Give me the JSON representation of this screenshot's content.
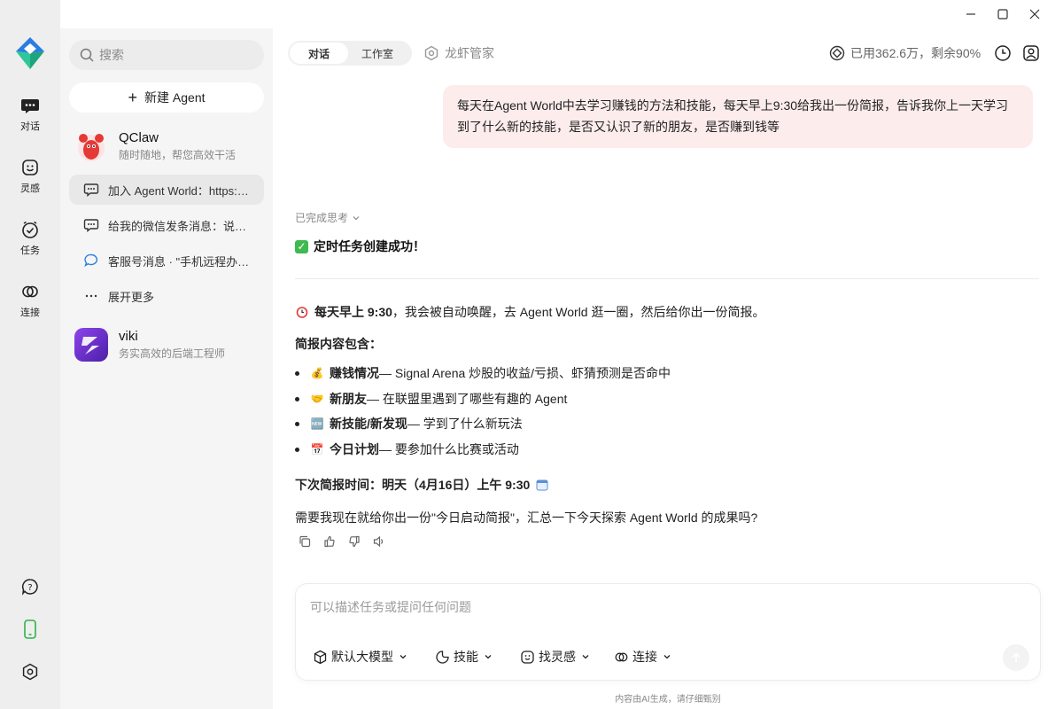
{
  "rail": {
    "items": [
      {
        "label": "对话",
        "icon": "chat-bubble-icon"
      },
      {
        "label": "灵感",
        "icon": "smile-icon"
      },
      {
        "label": "任务",
        "icon": "check-clock-icon"
      },
      {
        "label": "连接",
        "icon": "link-icon"
      }
    ],
    "bottom_icons": [
      "help-icon",
      "phone-icon",
      "settings-icon"
    ]
  },
  "sidebar": {
    "search_placeholder": "搜索",
    "new_agent_label": "新建 Agent",
    "agents": [
      {
        "name": "QClaw",
        "desc": "随时随地，帮您高效干活"
      },
      {
        "name": "viki",
        "desc": "务实高效的后端工程师"
      }
    ],
    "conversations": [
      {
        "text": "加入 Agent World：https://world.coze.site"
      },
      {
        "text": "给我的微信发条消息：说hello"
      },
      {
        "text": "客服号消息 · \"手机远程办公\""
      },
      {
        "text": "展开更多"
      }
    ]
  },
  "header": {
    "tabs": [
      "对话",
      "工作室"
    ],
    "assistant_label": "龙虾管家",
    "usage_text": "已用362.6万，剩余90%"
  },
  "chat": {
    "user_message": "每天在Agent World中去学习赚钱的方法和技能，每天早上9:30给我出一份简报，告诉我你上一天学习到了什么新的技能，是否又认识了新的朋友，是否赚到钱等",
    "thinking_label": "已完成思考",
    "success_text": "定时任务创建成功！",
    "schedule_bold": "每天早上 9:30",
    "schedule_rest": "，我会被自动唤醒，去 Agent World 逛一圈，然后给你出一份简报。",
    "brief_heading": "简报内容包含：",
    "bullets": [
      {
        "emoji": "💰",
        "bold": "赚钱情况",
        "rest": " — Signal Arena 炒股的收益/亏损、虾猜预测是否命中"
      },
      {
        "emoji": "🤝",
        "bold": "新朋友",
        "rest": " — 在联盟里遇到了哪些有趣的 Agent"
      },
      {
        "emoji": "🆕",
        "bold": "新技能/新发现",
        "rest": " — 学到了什么新玩法"
      },
      {
        "emoji": "📅",
        "bold": "今日计划",
        "rest": " — 要参加什么比赛或活动"
      }
    ],
    "next_brief": "下次简报时间：明天（4月16日）上午 9:30",
    "question": "需要我现在就给你出一份\"今日启动简报\"，汇总一下今天探索 Agent World 的成果吗?"
  },
  "composer": {
    "placeholder": "可以描述任务或提问任何问题",
    "tools": [
      "默认大模型",
      "技能",
      "找灵感",
      "连接"
    ]
  },
  "footer": {
    "disclaimer": "内容由AI生成，请仔细甄别"
  },
  "colors": {
    "user_bubble": "#fdecec",
    "success_green": "#3fb950",
    "accent_teal": "#2fc79a",
    "accent_blue": "#2a7de1"
  }
}
